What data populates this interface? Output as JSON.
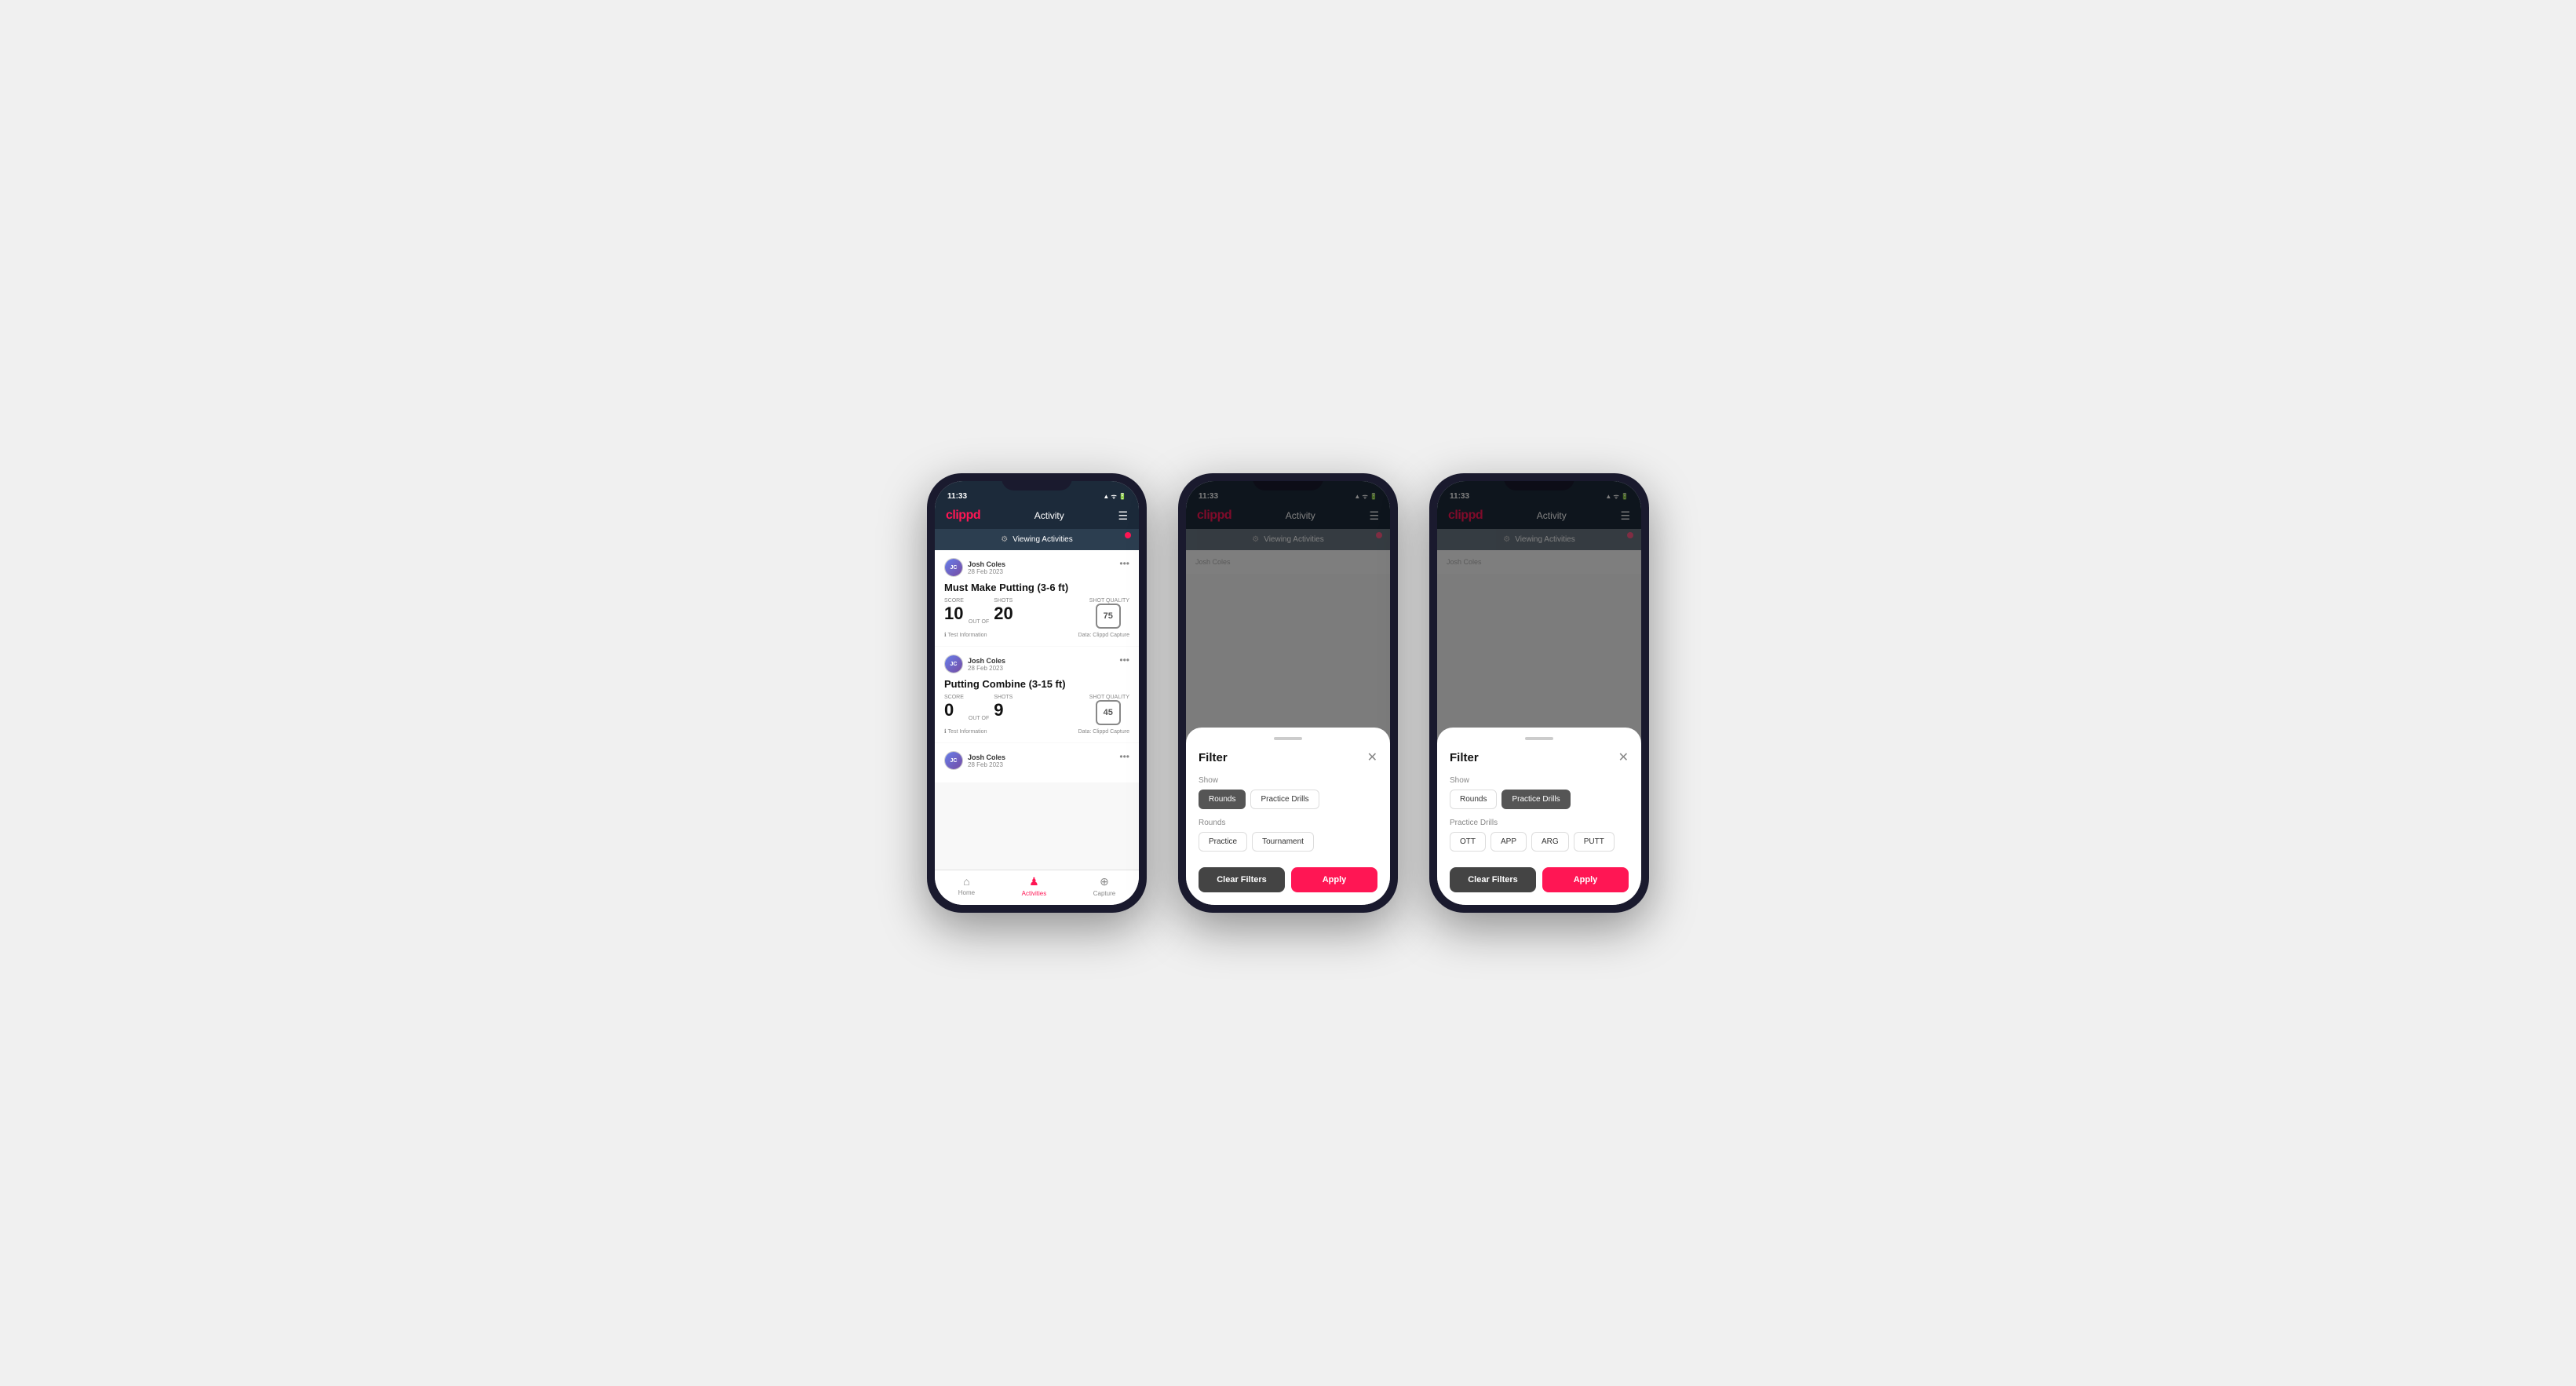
{
  "app": {
    "logo": "clippd",
    "header_title": "Activity",
    "status_time": "11:33",
    "status_icons": "▲ ᯤ 🔋"
  },
  "viewing_bar": {
    "text": "Viewing Activities",
    "icon": "⚙"
  },
  "phone1": {
    "cards": [
      {
        "user_name": "Josh Coles",
        "user_date": "28 Feb 2023",
        "title": "Must Make Putting (3-6 ft)",
        "score_label": "Score",
        "score_value": "10",
        "shots_label": "Shots",
        "shots_value": "20",
        "shot_quality_label": "Shot Quality",
        "shot_quality_value": "75",
        "info": "Test Information",
        "data_source": "Data: Clippd Capture"
      },
      {
        "user_name": "Josh Coles",
        "user_date": "28 Feb 2023",
        "title": "Putting Combine (3-15 ft)",
        "score_label": "Score",
        "score_value": "0",
        "shots_label": "Shots",
        "shots_value": "9",
        "shot_quality_label": "Shot Quality",
        "shot_quality_value": "45",
        "info": "Test Information",
        "data_source": "Data: Clippd Capture"
      },
      {
        "user_name": "Josh Coles",
        "user_date": "28 Feb 2023",
        "title": "",
        "score_label": "",
        "score_value": "",
        "shots_label": "",
        "shots_value": "",
        "shot_quality_label": "",
        "shot_quality_value": "",
        "info": "",
        "data_source": ""
      }
    ],
    "nav": {
      "home_label": "Home",
      "activities_label": "Activities",
      "capture_label": "Capture"
    }
  },
  "phone2": {
    "filter": {
      "title": "Filter",
      "show_label": "Show",
      "show_buttons": [
        {
          "label": "Rounds",
          "active": true
        },
        {
          "label": "Practice Drills",
          "active": false
        }
      ],
      "rounds_label": "Rounds",
      "rounds_buttons": [
        {
          "label": "Practice",
          "active": false
        },
        {
          "label": "Tournament",
          "active": false
        }
      ],
      "clear_label": "Clear Filters",
      "apply_label": "Apply"
    }
  },
  "phone3": {
    "filter": {
      "title": "Filter",
      "show_label": "Show",
      "show_buttons": [
        {
          "label": "Rounds",
          "active": false
        },
        {
          "label": "Practice Drills",
          "active": true
        }
      ],
      "practice_drills_label": "Practice Drills",
      "practice_buttons": [
        {
          "label": "OTT",
          "active": false
        },
        {
          "label": "APP",
          "active": false
        },
        {
          "label": "ARG",
          "active": false
        },
        {
          "label": "PUTT",
          "active": false
        }
      ],
      "clear_label": "Clear Filters",
      "apply_label": "Apply"
    }
  }
}
